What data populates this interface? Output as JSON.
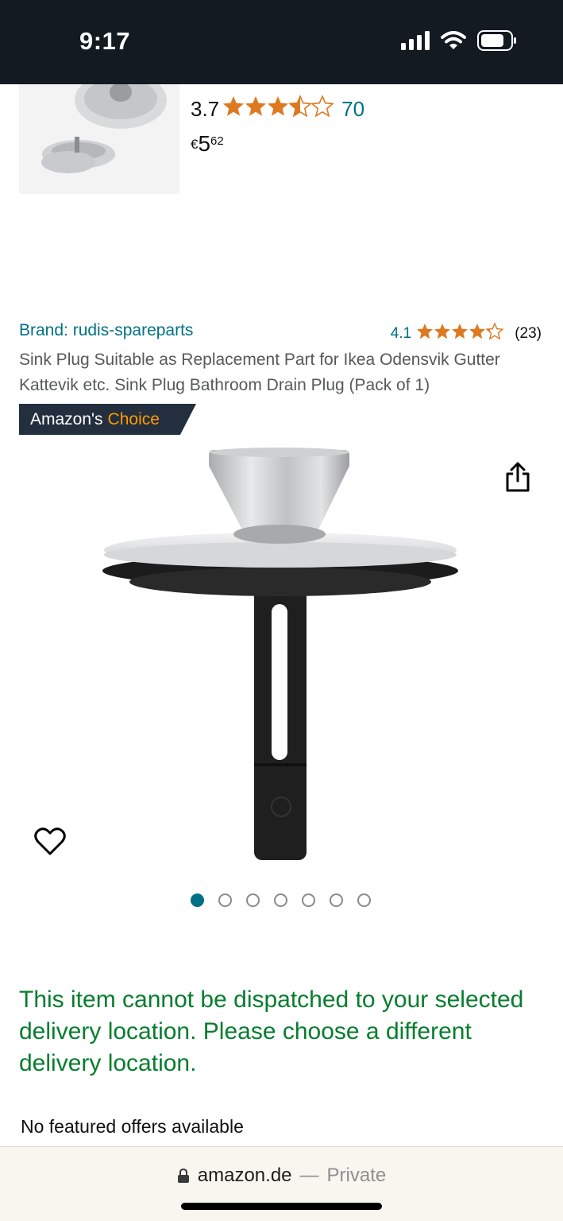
{
  "status_bar": {
    "time": "9:17"
  },
  "top_product": {
    "rating": "3.7",
    "stars_value": 3.7,
    "review_count": "70",
    "price_symbol": "€",
    "price_whole": "5",
    "price_fraction": "62"
  },
  "product": {
    "brand": "Brand: rudis-spareparts",
    "rating": "4.1",
    "stars_value": 4.1,
    "review_count": "(23)",
    "title": "Sink Plug Suitable as Replacement Part for Ikea Odensvik Gutter Kattevik etc. Sink Plug Bathroom Drain Plug (Pack of 1)",
    "badge_prefix": "Amazon's",
    "badge_accent": "Choice",
    "image_count": 7,
    "active_image": 1
  },
  "dispatch_message": "This item cannot be dispatched to your selected delivery location. Please choose a different delivery location.",
  "offers_text": "No featured offers available",
  "browser": {
    "domain": "amazon.de",
    "separator": "—",
    "mode": "Private"
  },
  "colors": {
    "link": "#007185",
    "star": "#de7921",
    "success": "#067d2e",
    "badge_bg": "#232f3e",
    "badge_accent": "#ff9900"
  }
}
